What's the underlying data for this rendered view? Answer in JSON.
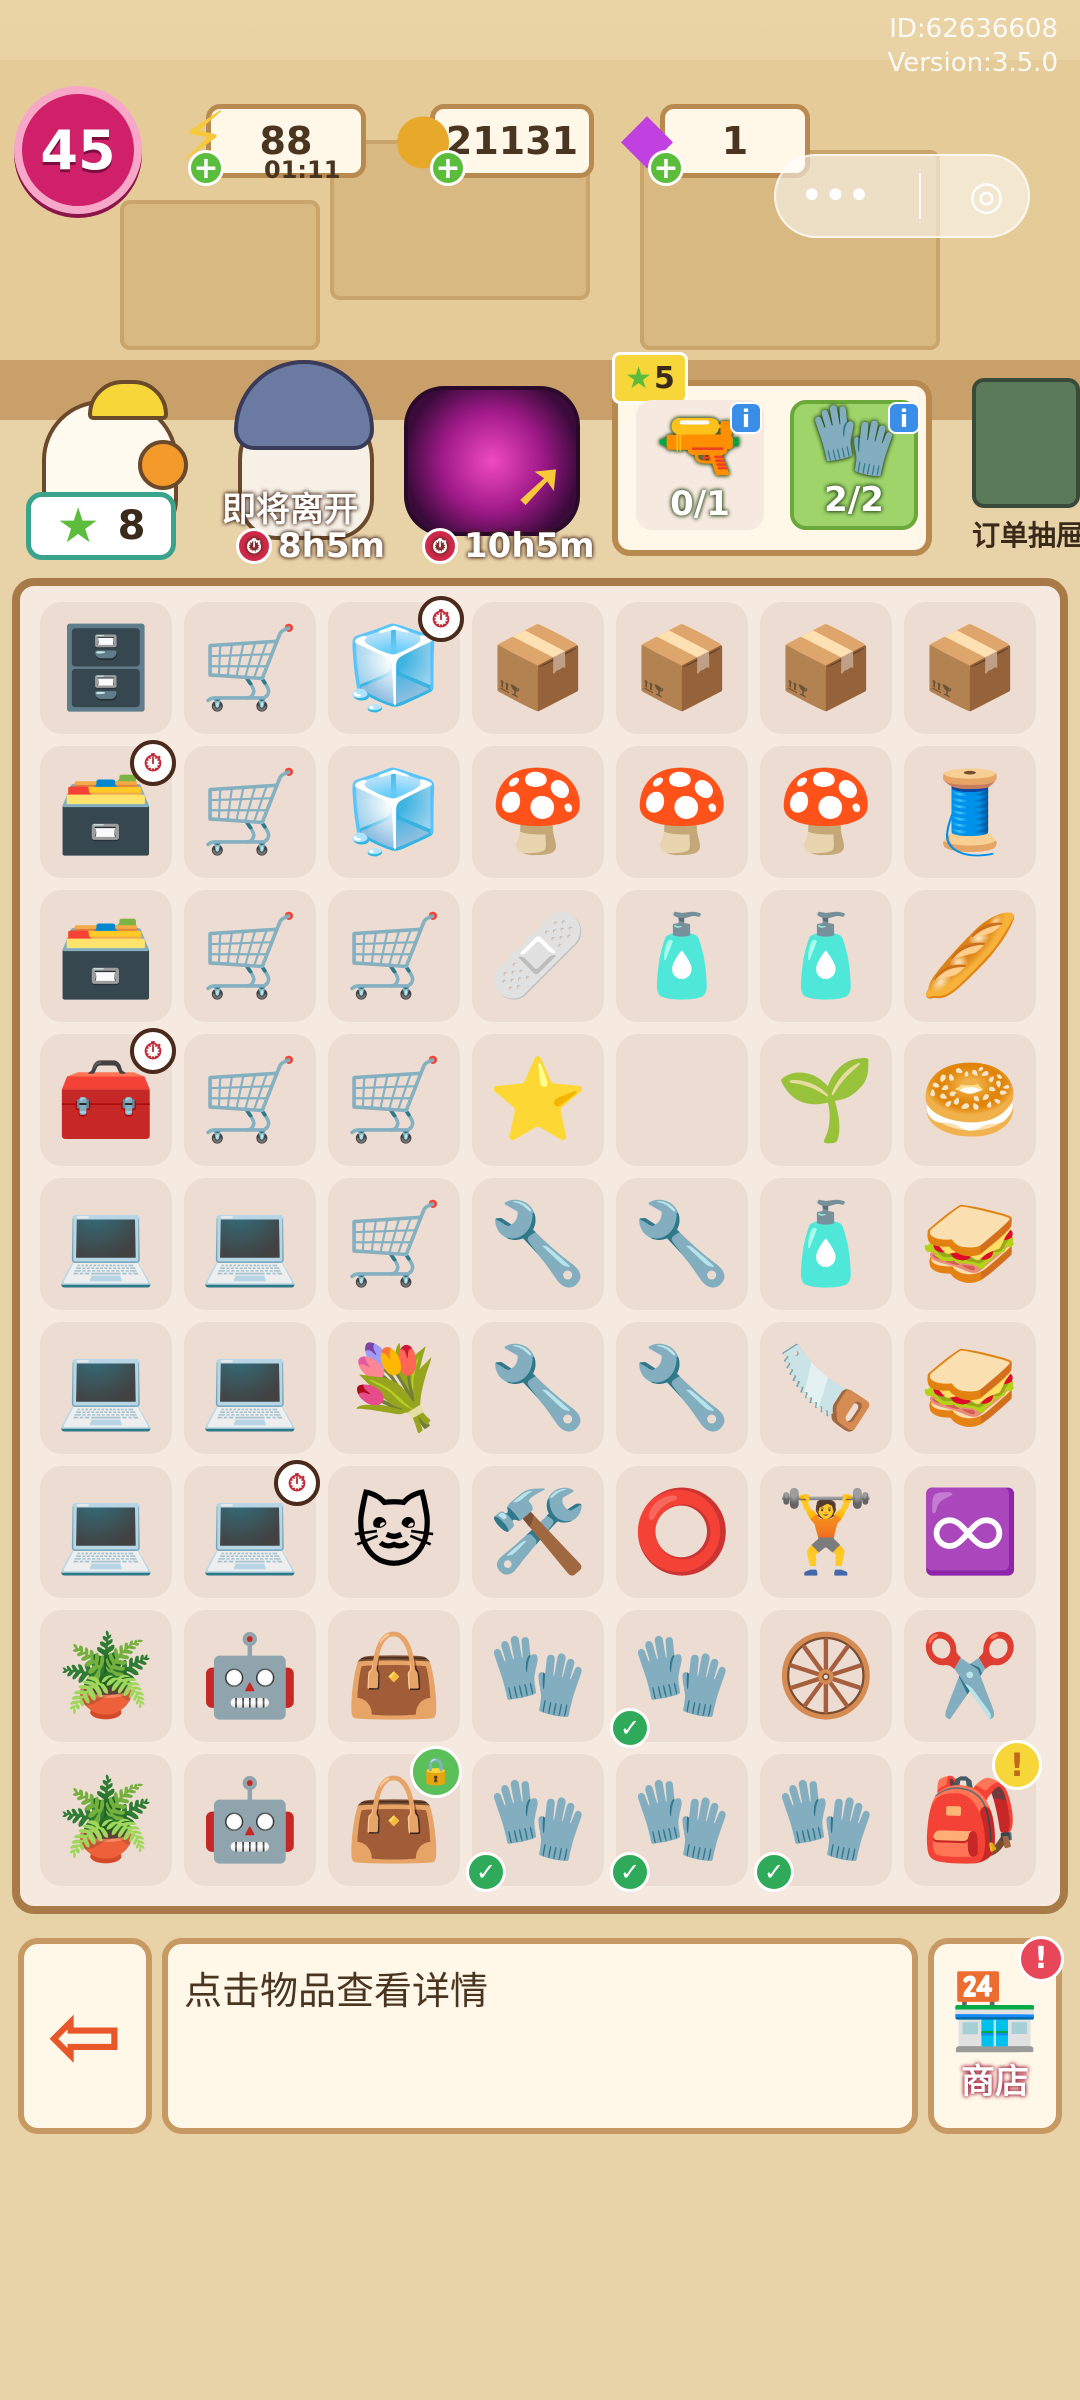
{
  "top_info": {
    "id": "ID:62636608",
    "version": "Version:3.5.0"
  },
  "level": "45",
  "resources": {
    "energy": {
      "value": "88",
      "timer": "01:11",
      "icon": "lightning-icon"
    },
    "coins": {
      "value": "21131",
      "icon": "coin-icon"
    },
    "gems": {
      "value": "1",
      "icon": "gem-icon"
    }
  },
  "mini_program_capsule": {
    "more": "•••",
    "close": "◎"
  },
  "customers": {
    "first": {
      "stars": "8"
    },
    "second": {
      "status": "即将离开",
      "timer": "8h5m"
    },
    "third": {
      "timer": "10h5m"
    }
  },
  "order": {
    "reward_stars": "5",
    "items": [
      {
        "name": "drill",
        "icon": "🔫",
        "progress": "0/1"
      },
      {
        "name": "gloves",
        "icon": "🧤",
        "progress": "2/2"
      }
    ]
  },
  "order_board_label": "订单抽屉",
  "board": {
    "rows": [
      [
        "🗄️",
        "🛒",
        "🧊",
        "📦",
        "📦",
        "📦",
        "📦"
      ],
      [
        "🗃️",
        "🛒",
        "🧊",
        "🍄",
        "🍄",
        "🍄",
        "🧵"
      ],
      [
        "🗃️",
        "🛒",
        "🛒",
        "🩹",
        "🧴",
        "🧴",
        "🥖"
      ],
      [
        "🧰",
        "🛒",
        "🛒",
        "⭐",
        "",
        "🌱",
        "🥯"
      ],
      [
        "💻",
        "💻",
        "🛒",
        "🔧",
        "🔧",
        "🧴",
        "🥪"
      ],
      [
        "💻",
        "💻",
        "💐",
        "🔧",
        "🔧",
        "🪚",
        "🥪"
      ],
      [
        "💻",
        "💻",
        "🐱",
        "🛠️",
        "⭕",
        "🏋️",
        "♾️"
      ],
      [
        "🪴",
        "🤖",
        "👜",
        "🧤",
        "🧤",
        "🛞",
        "✂️"
      ],
      [
        "🪴",
        "🤖",
        "👜",
        "🧤",
        "🧤",
        "🧤",
        "🎒"
      ]
    ],
    "hint": "点击物品查看详情"
  },
  "shop_label": "商店",
  "exit_icon": "exit-icon"
}
